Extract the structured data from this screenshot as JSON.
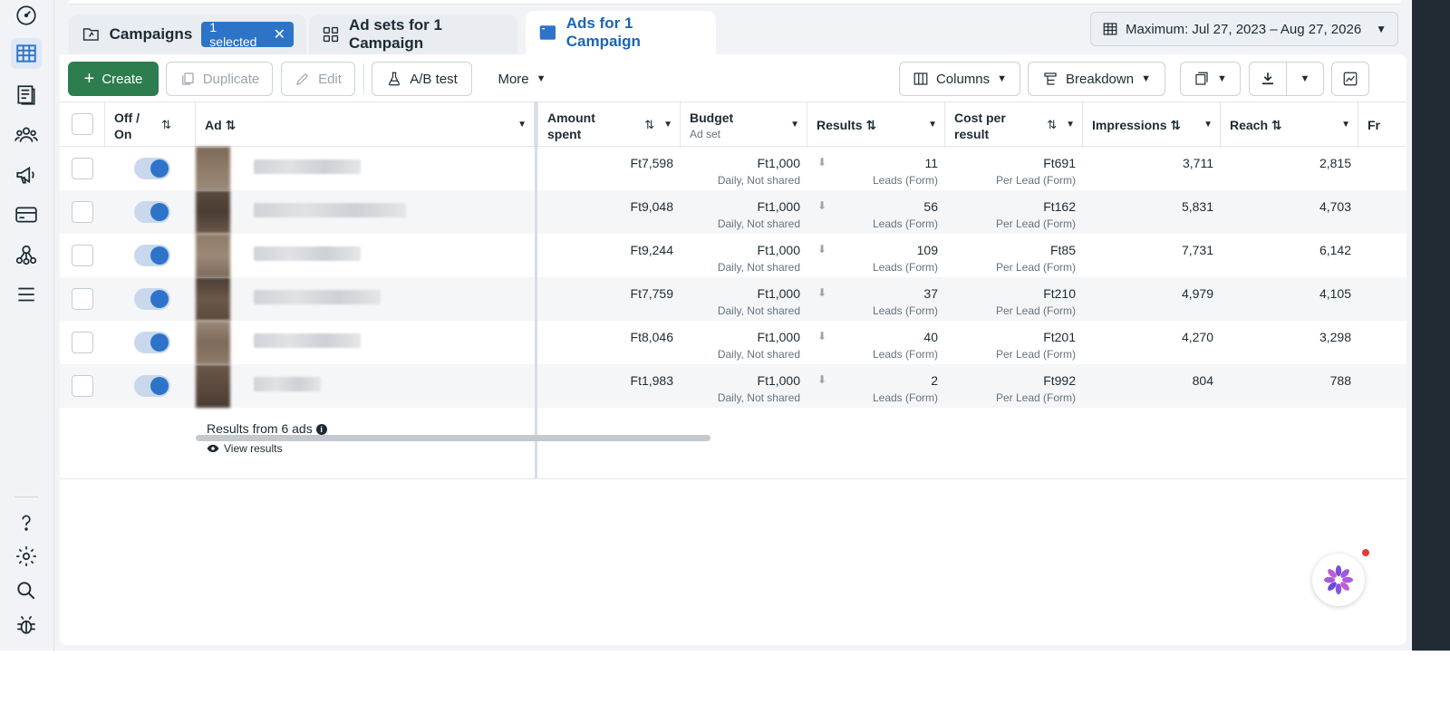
{
  "tabs": {
    "campaigns": "Campaigns",
    "selected_badge": "1 selected",
    "adsets": "Ad sets for 1 Campaign",
    "ads": "Ads for 1 Campaign"
  },
  "date_range": "Maximum: Jul 27, 2023 – Aug 27, 2026",
  "toolbar": {
    "create": "Create",
    "duplicate": "Duplicate",
    "edit": "Edit",
    "ab_test": "A/B test",
    "more": "More",
    "columns": "Columns",
    "breakdown": "Breakdown"
  },
  "columns": {
    "off_on_1": "Off /",
    "off_on_2": "On",
    "ad": "Ad",
    "amount_spent_1": "Amount",
    "amount_spent_2": "spent",
    "budget": "Budget",
    "budget_sub": "Ad set",
    "results": "Results",
    "cost_per_result_1": "Cost per",
    "cost_per_result_2": "result",
    "impressions": "Impressions",
    "reach": "Reach",
    "next": "Fr"
  },
  "rows": [
    {
      "amount": "Ft7,598",
      "budget": "Ft1,000",
      "budget_type": "Daily, Not shared",
      "results": "11",
      "results_type": "Leads (Form)",
      "cpr": "Ft691",
      "cpr_type": "Per Lead (Form)",
      "impressions": "3,711",
      "reach": "2,815"
    },
    {
      "amount": "Ft9,048",
      "budget": "Ft1,000",
      "budget_type": "Daily, Not shared",
      "results": "56",
      "results_type": "Leads (Form)",
      "cpr": "Ft162",
      "cpr_type": "Per Lead (Form)",
      "impressions": "5,831",
      "reach": "4,703"
    },
    {
      "amount": "Ft9,244",
      "budget": "Ft1,000",
      "budget_type": "Daily, Not shared",
      "results": "109",
      "results_type": "Leads (Form)",
      "cpr": "Ft85",
      "cpr_type": "Per Lead (Form)",
      "impressions": "7,731",
      "reach": "6,142"
    },
    {
      "amount": "Ft7,759",
      "budget": "Ft1,000",
      "budget_type": "Daily, Not shared",
      "results": "37",
      "results_type": "Leads (Form)",
      "cpr": "Ft210",
      "cpr_type": "Per Lead (Form)",
      "impressions": "4,979",
      "reach": "4,105"
    },
    {
      "amount": "Ft8,046",
      "budget": "Ft1,000",
      "budget_type": "Daily, Not shared",
      "results": "40",
      "results_type": "Leads (Form)",
      "cpr": "Ft201",
      "cpr_type": "Per Lead (Form)",
      "impressions": "4,270",
      "reach": "3,298"
    },
    {
      "amount": "Ft1,983",
      "budget": "Ft1,000",
      "budget_type": "Daily, Not shared",
      "results": "2",
      "results_type": "Leads (Form)",
      "cpr": "Ft992",
      "cpr_type": "Per Lead (Form)",
      "impressions": "804",
      "reach": "788"
    }
  ],
  "footer": {
    "results_from": "Results from 6 ads",
    "view_results": "View results"
  },
  "colors": {
    "primary_green": "#2e7d4f",
    "accent_blue": "#2d74c9",
    "active_tab_text": "#1a65b7"
  }
}
